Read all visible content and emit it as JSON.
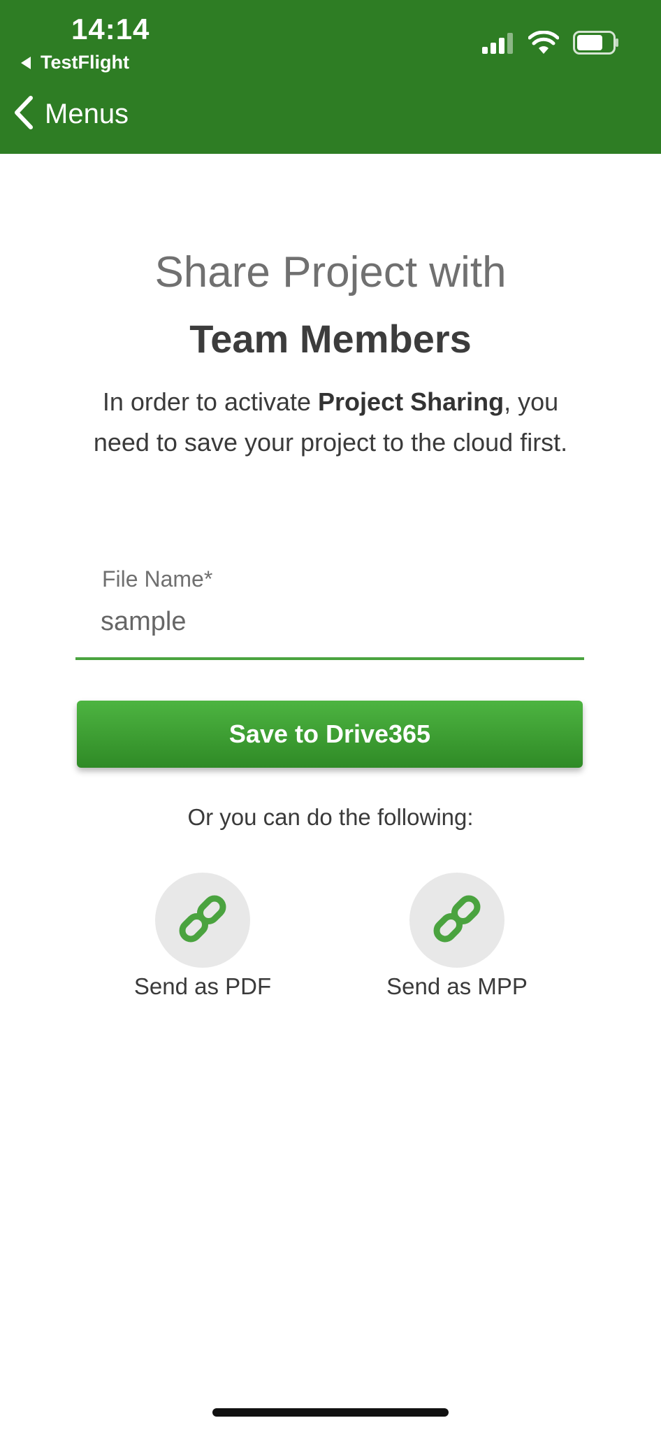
{
  "status_bar": {
    "time": "14:14",
    "back_app": "TestFlight"
  },
  "nav": {
    "back_label": "Menus"
  },
  "main": {
    "heading_line1": "Share Project with",
    "heading_line2": "Team Members",
    "description_pre": "In order to activate ",
    "description_bold": "Project Sharing",
    "description_post": ", you need to save your project to the cloud first."
  },
  "form": {
    "file_name_label": "File Name*",
    "file_name_value": "sample",
    "save_button": "Save to Drive365"
  },
  "alternatives": {
    "intro": "Or you can do the following:",
    "options": [
      {
        "label": "Send as PDF",
        "icon": "link-icon"
      },
      {
        "label": "Send as MPP",
        "icon": "link-icon"
      }
    ]
  },
  "colors": {
    "header_green": "#2e7d24",
    "accent_green": "#4aa33f",
    "icon_circle": "#e8e8e8"
  }
}
